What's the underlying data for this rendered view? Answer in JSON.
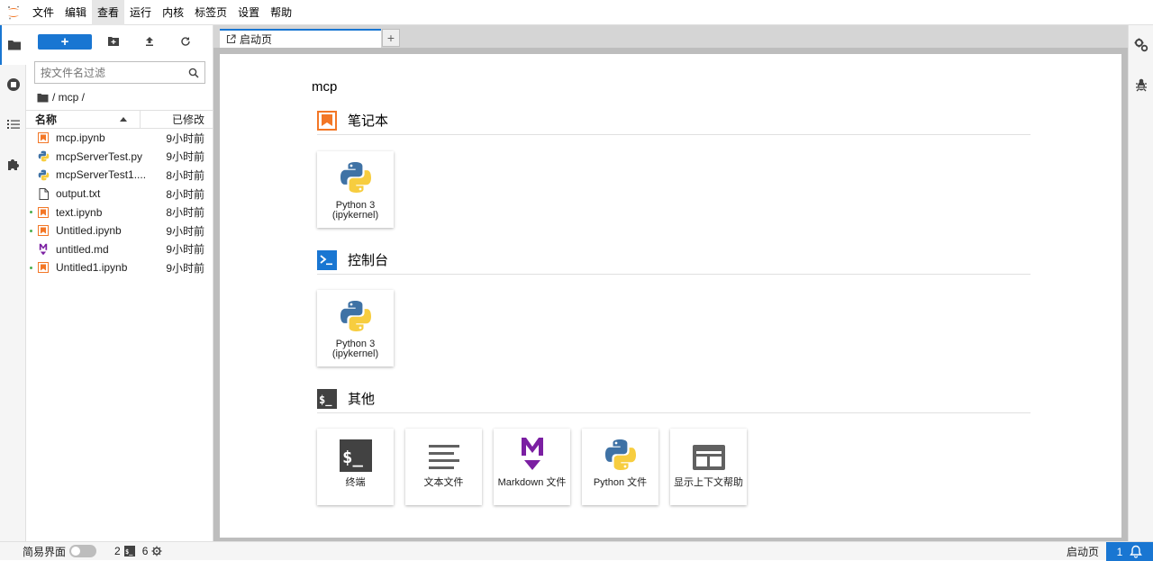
{
  "menubar": {
    "items": [
      "文件",
      "编辑",
      "查看",
      "运行",
      "内核",
      "标签页",
      "设置",
      "帮助"
    ],
    "active_index": 2
  },
  "filebrowser": {
    "new_button_label": "+",
    "filter_placeholder": "按文件名过滤",
    "breadcrumb": "/ mcp /",
    "header_name": "名称",
    "header_modified": "已修改",
    "files": [
      {
        "name": "mcp.ipynb",
        "type": "notebook",
        "modified": "9小时前",
        "running": false
      },
      {
        "name": "mcpServerTest.py",
        "type": "python",
        "modified": "9小时前",
        "running": false
      },
      {
        "name": "mcpServerTest1....",
        "type": "python",
        "modified": "8小时前",
        "running": false
      },
      {
        "name": "output.txt",
        "type": "text",
        "modified": "8小时前",
        "running": false
      },
      {
        "name": "text.ipynb",
        "type": "notebook",
        "modified": "8小时前",
        "running": true
      },
      {
        "name": "Untitled.ipynb",
        "type": "notebook",
        "modified": "9小时前",
        "running": true
      },
      {
        "name": "untitled.md",
        "type": "markdown",
        "modified": "9小时前",
        "running": false
      },
      {
        "name": "Untitled1.ipynb",
        "type": "notebook",
        "modified": "9小时前",
        "running": true
      }
    ]
  },
  "tabs": {
    "launcher_label": "启动页",
    "add_label": "+"
  },
  "launcher": {
    "cwd": "mcp",
    "sections": {
      "notebook": {
        "title": "笔记本",
        "cards": [
          {
            "label": "Python 3 (ipykernel)"
          }
        ]
      },
      "console": {
        "title": "控制台",
        "cards": [
          {
            "label": "Python 3 (ipykernel)"
          }
        ]
      },
      "other": {
        "title": "其他",
        "cards": [
          {
            "label": "终端"
          },
          {
            "label": "文本文件"
          },
          {
            "label": "Markdown 文件"
          },
          {
            "label": "Python 文件"
          },
          {
            "label": "显示上下文帮助"
          }
        ]
      }
    }
  },
  "statusbar": {
    "simple_mode_label": "简易界面",
    "kernels_count": "2",
    "terminals_count": "6",
    "right_label": "启动页",
    "notification_count": "1"
  },
  "colors": {
    "accent": "#1976d2",
    "notebook_orange": "#f37726",
    "markdown_purple": "#7b1fa2",
    "running_green": "#4caf50"
  }
}
